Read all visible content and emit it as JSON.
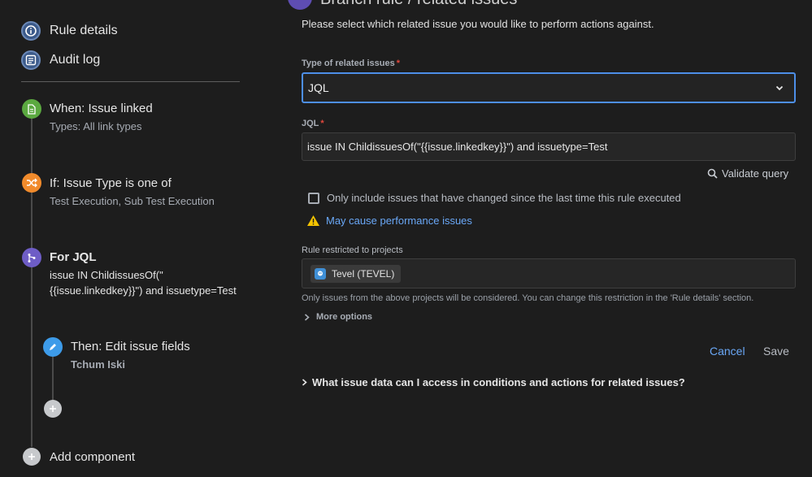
{
  "sidebar": {
    "nav": [
      {
        "label": "Rule details",
        "icon": "info-icon"
      },
      {
        "label": "Audit log",
        "icon": "list-icon"
      }
    ],
    "steps": {
      "trigger": {
        "title": "When: Issue linked",
        "subtitle": "Types: All link types",
        "icon": "document-icon",
        "color": "#5ba940"
      },
      "condition": {
        "title": "If: Issue Type is one of",
        "subtitle": "Test Execution, Sub Test Execution",
        "icon": "shuffle-icon",
        "color": "#f18b2c"
      },
      "branch": {
        "title": "For JQL",
        "line1": "issue IN ChildissuesOf(\"",
        "line2": "{{issue.linkedkey}}\") and issuetype=Test",
        "icon": "branch-icon",
        "color": "#6e5dc6"
      },
      "action": {
        "title": "Then: Edit issue fields",
        "subtitle": "Tchum Iski",
        "icon": "pencil-icon",
        "color": "#3d9be9"
      }
    },
    "add_component_label": "Add component"
  },
  "main": {
    "header_title": "Branch rule / related issues",
    "intro": "Please select which related issue you would like to perform actions against.",
    "type_label": "Type of related issues",
    "type_value": "JQL",
    "jql_label": "JQL",
    "jql_value": "issue IN ChildissuesOf(\"{{issue.linkedkey}}\") and issuetype=Test",
    "validate_label": "Validate query",
    "checkbox_label": "Only include issues that have changed since the last time this rule executed",
    "warning_label": "May cause performance issues",
    "projects_label": "Rule restricted to projects",
    "project_tag": "Tevel (TEVEL)",
    "projects_hint": "Only issues from the above projects will be considered. You can change this restriction in the 'Rule details' section.",
    "more_options": "More options",
    "cancel": "Cancel",
    "save": "Save",
    "faq": "What issue data can I access in conditions and actions for related issues?"
  },
  "colors": {
    "accent_blue": "#4d8fe8",
    "link_blue": "#6aa8f7",
    "required_red": "#e2483d",
    "warning_yellow": "#f5c400"
  }
}
